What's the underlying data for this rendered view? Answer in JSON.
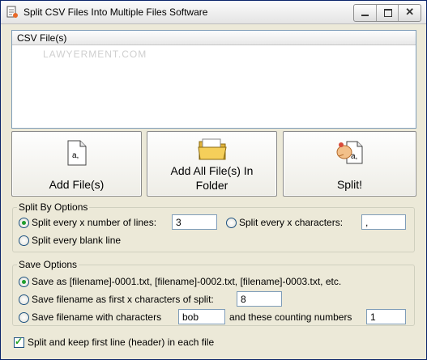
{
  "window": {
    "title": "Split CSV Files Into Multiple Files Software"
  },
  "titlebar_icons": {
    "minimize": "minimize-icon",
    "maximize": "maximize-icon",
    "close": "close-icon",
    "close_glyph": "✕"
  },
  "file_list": {
    "column_header": "CSV File(s)",
    "watermark": "LAWYERMENT.COM"
  },
  "actions": {
    "add_files": {
      "label": "Add File(s)",
      "icon": "document-icon",
      "icon_letter": "a,"
    },
    "add_folder": {
      "label_line1": "Add All File(s) In",
      "label_line2": "Folder",
      "icon": "folder-icon"
    },
    "split": {
      "label": "Split!",
      "icon": "split-icon",
      "icon_letter": "a,"
    }
  },
  "split_by": {
    "legend": "Split By Options",
    "lines": {
      "label": "Split every x number of lines:",
      "value": "3",
      "selected": true
    },
    "chars": {
      "label": "Split every x characters:",
      "value": ",",
      "selected": false
    },
    "blank": {
      "label": "Split every blank line",
      "selected": false
    }
  },
  "save_options": {
    "legend": "Save Options",
    "opt1": {
      "label": "Save as [filename]-0001.txt, [filename]-0002.txt, [filename]-0003.txt, etc.",
      "selected": true
    },
    "opt2": {
      "label": "Save filename as first x characters of split:",
      "value": "8",
      "selected": false
    },
    "opt3": {
      "label": "Save filename with characters",
      "value": "bob",
      "label2": "and these counting numbers",
      "value2": "1",
      "selected": false
    }
  },
  "header_checkbox": {
    "label": "Split and keep first line (header) in each file",
    "checked": true
  }
}
